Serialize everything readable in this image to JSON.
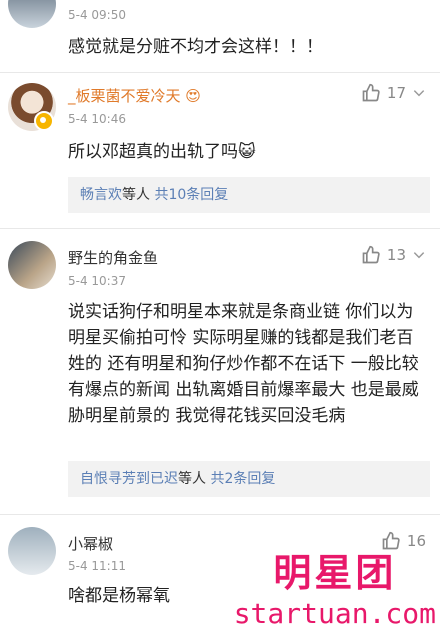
{
  "comments": [
    {
      "name": "",
      "time": "5-4 09:50",
      "text": "感觉就是分赃不均才会这样！！！"
    },
    {
      "name": "_板栗菌不爱冷天",
      "name_suffix": "😍",
      "time": "5-4 10:46",
      "text": "所以邓超真的出轨了吗😺",
      "likes": "17",
      "replies": {
        "users": "畅言欢",
        "mid": "等人",
        "count": "共10条回复"
      }
    },
    {
      "name": "野生的角金鱼",
      "time": "5-4 10:37",
      "text": "说实话狗仔和明星本来就是条商业链 你们以为明星买偷拍可怜 实际明星赚的钱都是我们老百姓的 还有明星和狗仔炒作都不在话下 一般比较有爆点的新闻 出轨离婚目前爆率最大 也是最威胁明星前景的 我觉得花钱买回没毛病",
      "likes": "13",
      "replies": {
        "users": "自恨寻芳到已迟",
        "mid": "等人",
        "count": "共2条回复"
      }
    },
    {
      "name": "小幂椒",
      "time": "5-4 11:11",
      "text": "啥都是杨幂氧",
      "likes": "16"
    }
  ],
  "watermark": {
    "title": "明星团",
    "url": "startuan.com"
  },
  "colors": {
    "link": "#5b7fb5",
    "name_link": "#e07a2a",
    "watermark": "#e8186a"
  },
  "icons": [
    "thumbs-up-icon",
    "chevron-down-icon",
    "vip-badge-icon"
  ]
}
